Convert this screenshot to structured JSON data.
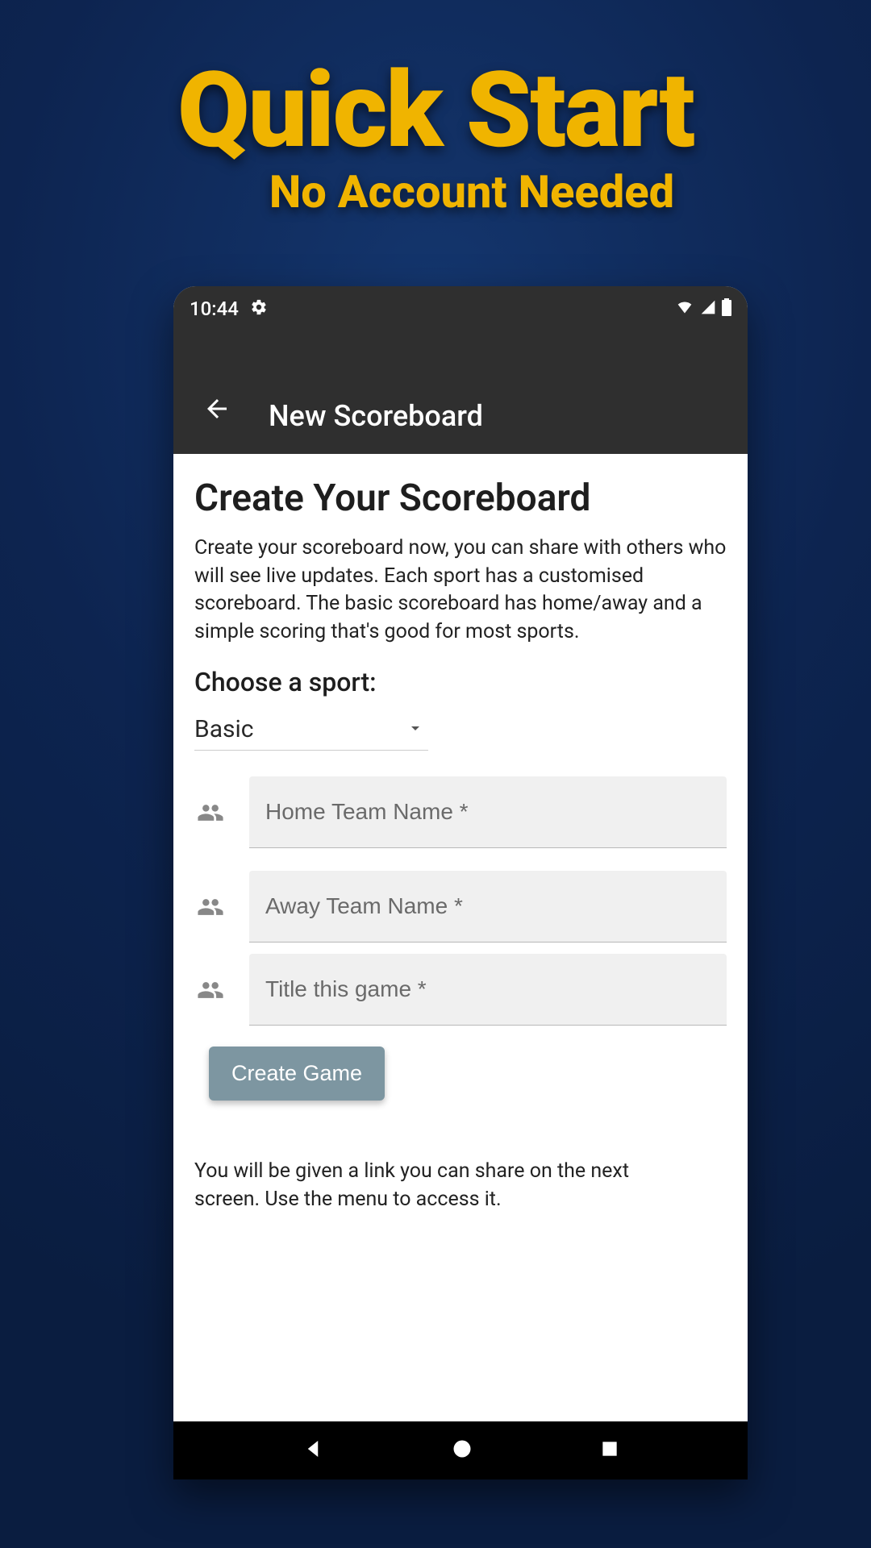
{
  "hero": {
    "title": "Quick Start",
    "subtitle": "No Account Needed"
  },
  "statusbar": {
    "time": "10:44"
  },
  "appbar": {
    "title": "New Scoreboard"
  },
  "page": {
    "heading": "Create Your Scoreboard",
    "description": "Create your scoreboard now, you can share with others who will see live updates. Each sport has a customised scoreboard. The basic scoreboard has home/away and a simple scoring that's good for most sports.",
    "section_label": "Choose a sport:"
  },
  "sport_select": {
    "value": "Basic"
  },
  "fields": {
    "home_placeholder": "Home Team Name *",
    "away_placeholder": "Away Team Name *",
    "title_placeholder": "Title this game *",
    "home_value": "",
    "away_value": "",
    "title_value": ""
  },
  "actions": {
    "create_label": "Create Game"
  },
  "footer": {
    "note": "You will be given a link you can share on the next screen. Use the menu to access it."
  }
}
